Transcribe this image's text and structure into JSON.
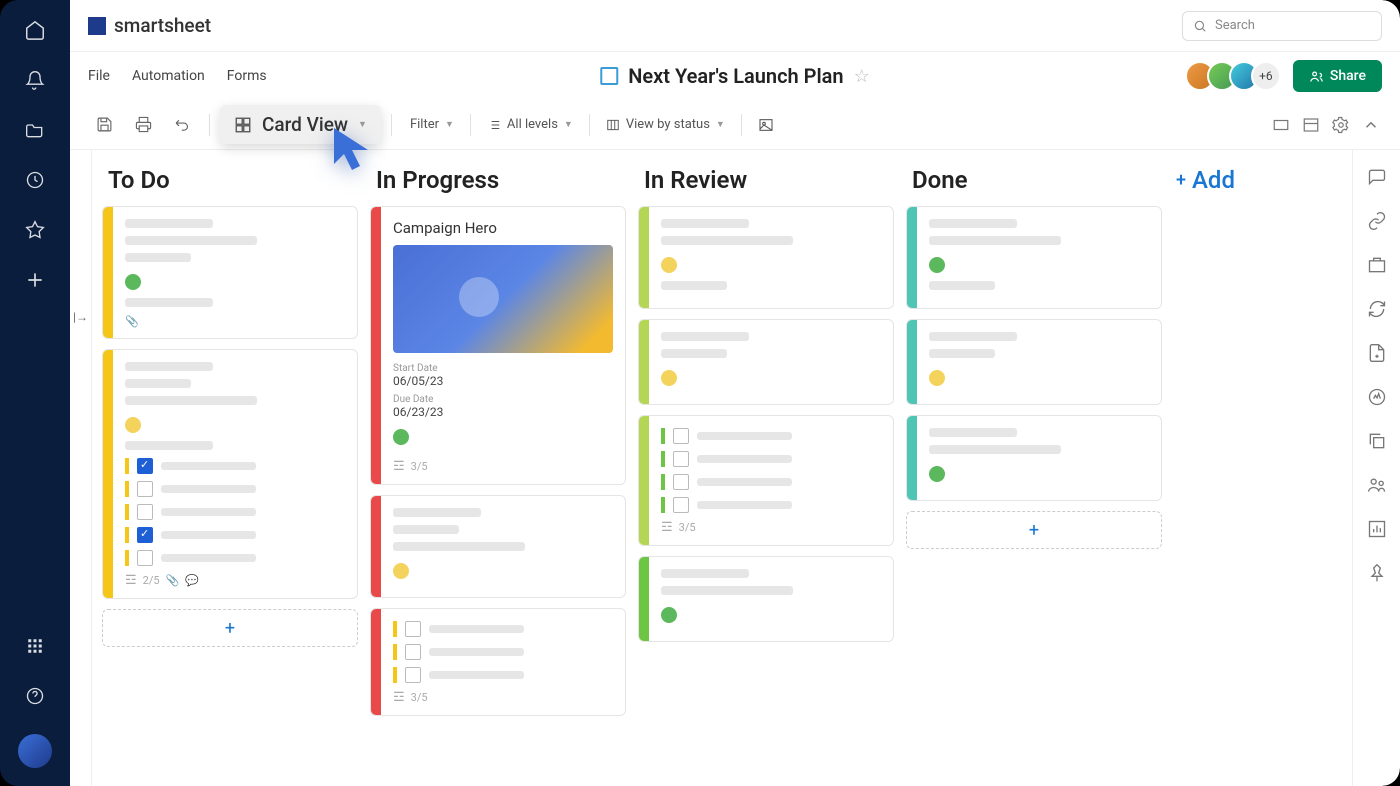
{
  "brand": "smartsheet",
  "search_placeholder": "Search",
  "menubar": {
    "file": "File",
    "automation": "Automation",
    "forms": "Forms"
  },
  "sheet": {
    "title": "Next Year's Launch Plan",
    "extra_people": "+6",
    "share_label": "Share"
  },
  "toolbar": {
    "view_label": "Card View",
    "filter": "Filter",
    "all_levels": "All levels",
    "view_by": "View by status"
  },
  "lanes": [
    {
      "title": "To Do"
    },
    {
      "title": "In Progress"
    },
    {
      "title": "In Review"
    },
    {
      "title": "Done"
    }
  ],
  "add_lane": "Add",
  "hero_card": {
    "title": "Campaign Hero",
    "start_label": "Start Date",
    "start": "06/05/23",
    "due_label": "Due Date",
    "due": "06/23/23",
    "progress": "3/5"
  },
  "todo_progress": "2/5",
  "inreview_progress": "3/5"
}
